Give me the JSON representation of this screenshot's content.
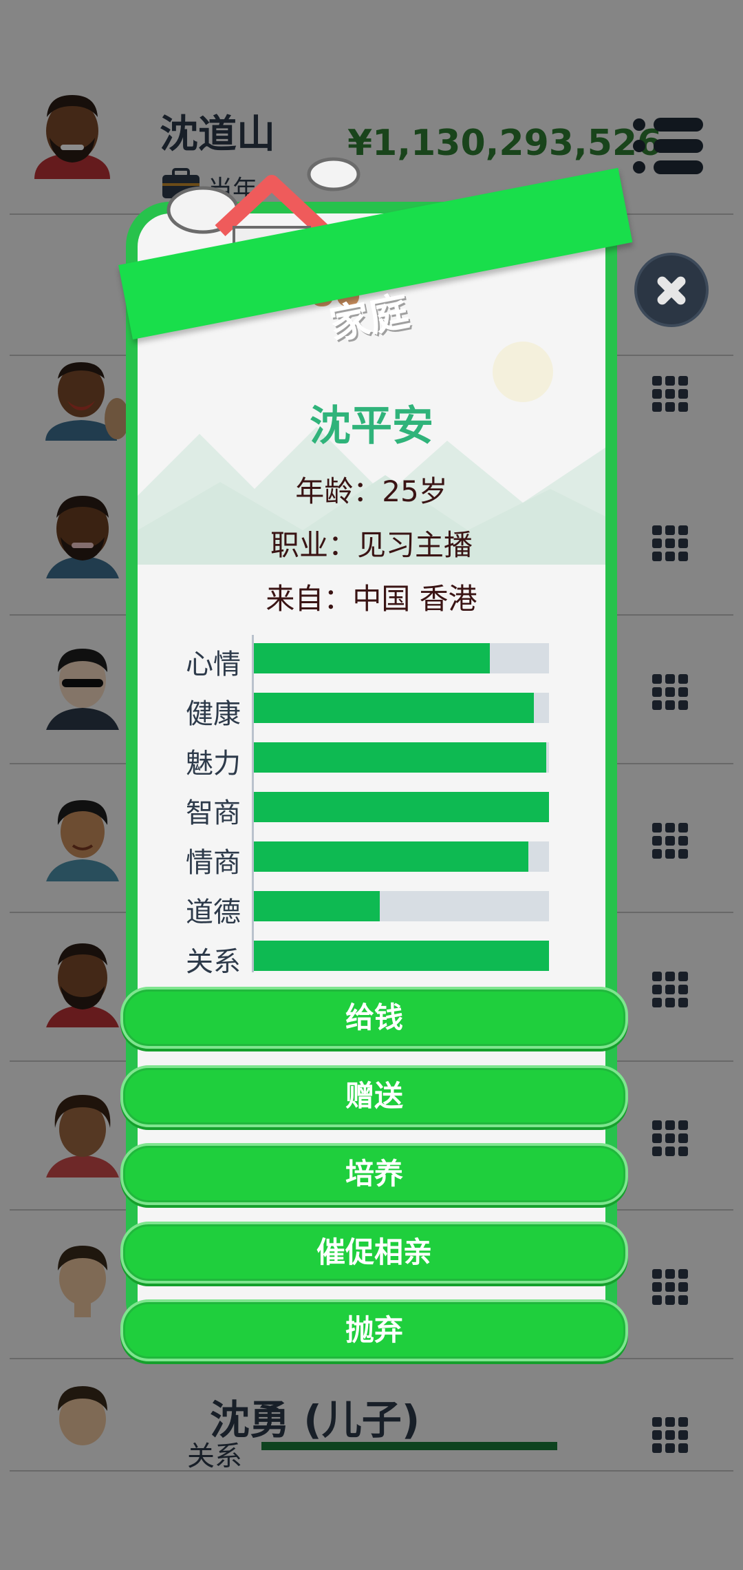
{
  "header": {
    "name": "沈道山",
    "sub_text": "当年",
    "money": "¥1,130,293,526"
  },
  "bottom_row": {
    "name": "沈勇 (儿子)",
    "label": "关系",
    "relation_level": 1.0
  },
  "popup": {
    "title": "家庭",
    "person_name": "沈平安",
    "age": "年龄：25岁",
    "job": "职业：见习主播",
    "origin": "来自：中国 香港",
    "stats": [
      {
        "label": "心情",
        "value": 0.8
      },
      {
        "label": "健康",
        "value": 0.95
      },
      {
        "label": "魅力",
        "value": 0.99
      },
      {
        "label": "智商",
        "value": 1.0
      },
      {
        "label": "情商",
        "value": 0.93
      },
      {
        "label": "道德",
        "value": 0.43
      },
      {
        "label": "关系",
        "value": 1.0
      }
    ],
    "buttons": [
      "给钱",
      "赠送",
      "培养",
      "催促相亲",
      "抛弃"
    ]
  },
  "icons": {
    "menu": "menu-list-icon",
    "close": "close-icon",
    "row_action": "grid-icon",
    "briefcase": "briefcase-icon"
  },
  "colors": {
    "accent_green": "#19de4b",
    "stat_fill": "#0eba52",
    "money_green": "#2e7d32",
    "name_teal": "#2fb37a"
  }
}
